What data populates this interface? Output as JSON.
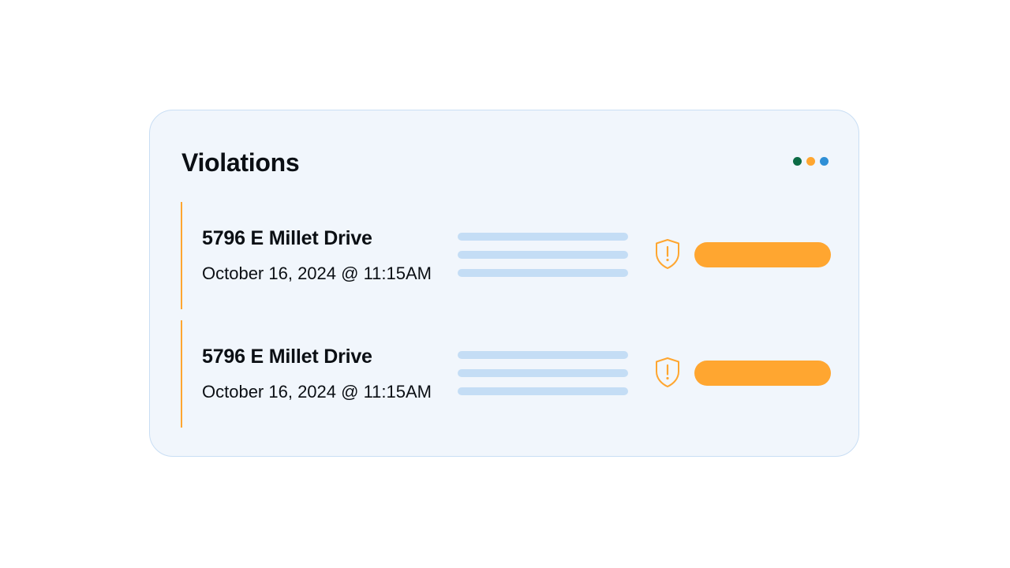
{
  "panel": {
    "title": "Violations",
    "menu_dots": [
      {
        "name": "green",
        "color": "#0c6b45"
      },
      {
        "name": "orange",
        "color": "#ffa630"
      },
      {
        "name": "blue",
        "color": "#2f8fd6"
      }
    ]
  },
  "violations": [
    {
      "address": "5796 E Millet Drive",
      "datetime": "October 16, 2024 @ 11:15AM",
      "icon": "shield-alert-icon"
    },
    {
      "address": "5796 E Millet Drive",
      "datetime": "October 16, 2024 @ 11:15AM",
      "icon": "shield-alert-icon"
    }
  ],
  "colors": {
    "accent": "#ffa630",
    "card_background": "#f1f6fc",
    "card_border": "#c9def4",
    "placeholder_line": "#c4ddf5"
  }
}
